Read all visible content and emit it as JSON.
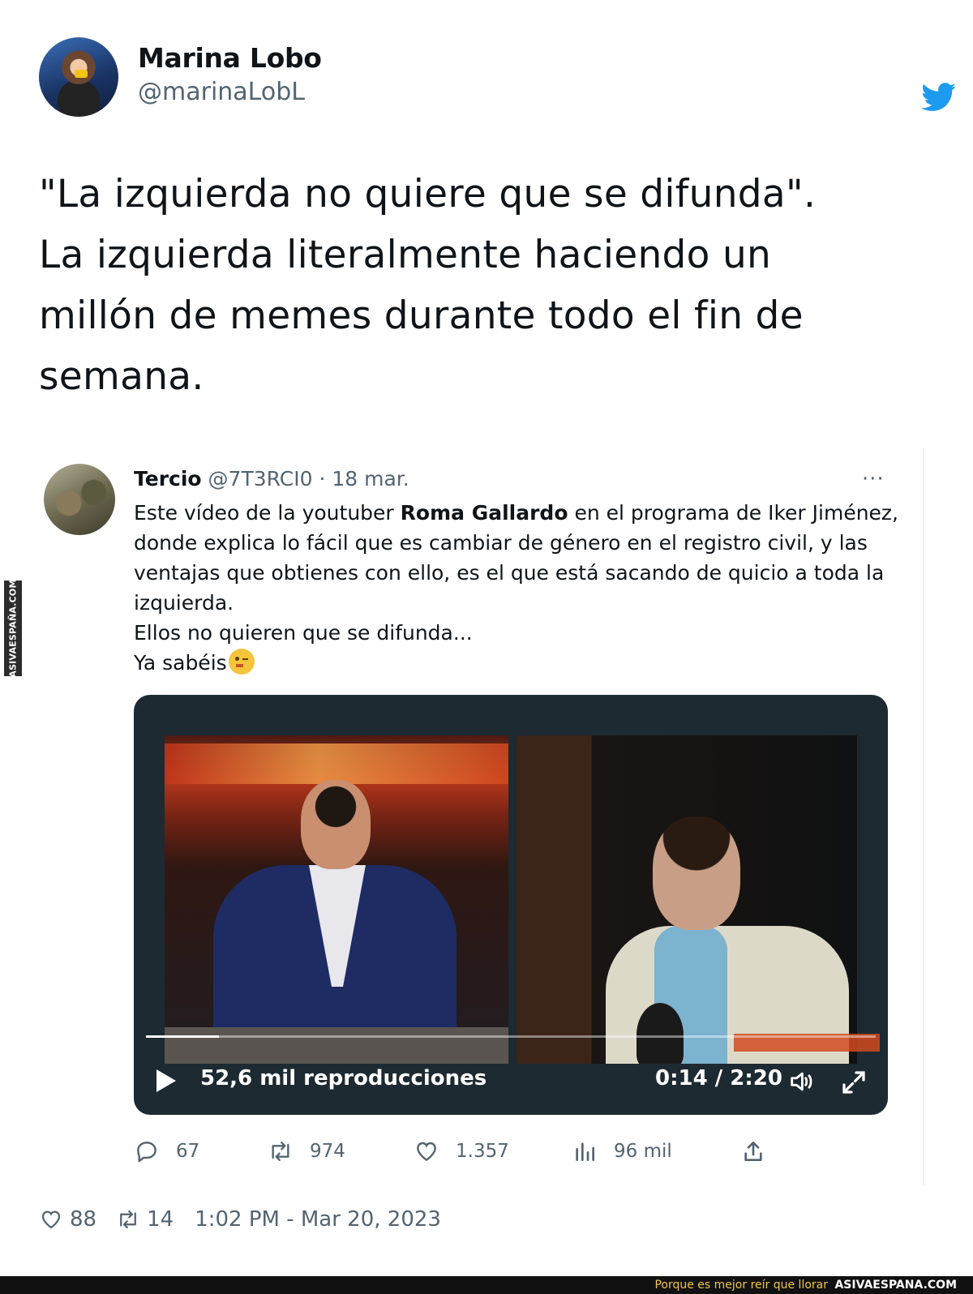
{
  "author": {
    "name": "Marina Lobo",
    "handle": "@marinaLobL"
  },
  "tweet": {
    "lines": [
      "\"La izquierda no quiere que se difunda\".",
      "La izquierda literalmente haciendo un",
      "millón de memes durante todo el fin de",
      "semana."
    ]
  },
  "quoted": {
    "name": "Tercio",
    "handle": "@7T3RCI0",
    "separator": "·",
    "date": "18 mar.",
    "more": "···",
    "text": {
      "part1": "Este vídeo de la youtuber ",
      "bold": "Roma Gallardo",
      "part2": " en el programa de Iker Jiménez, donde explica lo fácil que es cambiar de género en el registro civil, y las ventajas que obtienes con ello, es el que está sacando de quicio a toda la izquierda.",
      "line2": "Ellos no quieren que se difunda...",
      "line3": "Ya sabéis"
    },
    "video": {
      "views": "52,6 mil reproducciones",
      "time": "0:14 / 2:20",
      "progress": 0.1
    },
    "actions": {
      "replies": "67",
      "retweets": "974",
      "likes": "1.357",
      "views": "96 mil"
    }
  },
  "footer": {
    "likes": "88",
    "retweets": "14",
    "timestamp": "1:02 PM - Mar 20, 2023"
  },
  "watermark": {
    "side": "ASIVAESPAÑA.COM",
    "slogan": "Porque es mejor reír que llorar",
    "site": "ASIVAESPANA.COM"
  },
  "colors": {
    "twitter_blue": "#1d9bf0",
    "secondary_text": "#536471"
  }
}
